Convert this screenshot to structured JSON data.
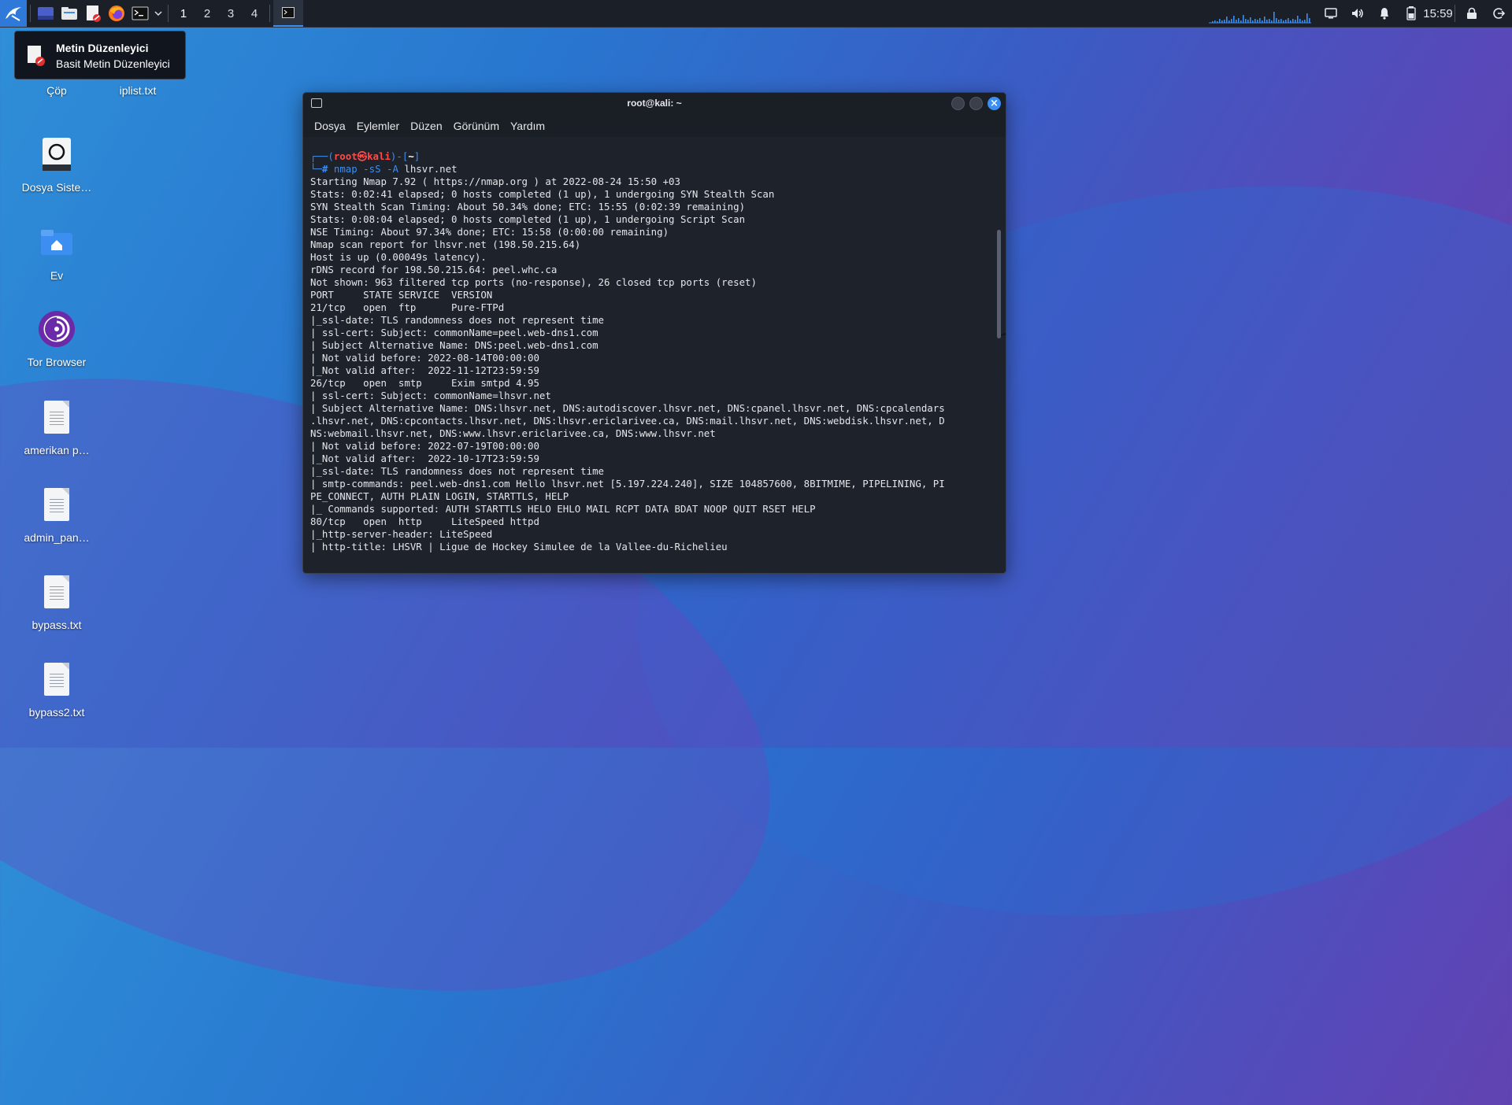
{
  "taskbar": {
    "workspaces": [
      "1",
      "2",
      "3",
      "4"
    ],
    "clock": "15:59"
  },
  "tooltip": {
    "title": "Metin Düzenleyici",
    "subtitle": "Basit Metin Düzenleyici"
  },
  "desktop_icons": [
    {
      "label": "Çöp",
      "icon": "trash-icon"
    },
    {
      "label": "iplist.txt",
      "icon": "text-file-icon"
    },
    {
      "label": "Dosya Siste…",
      "icon": "filesystem-icon"
    },
    {
      "label": "Ev",
      "icon": "home-folder-icon"
    },
    {
      "label": "Tor Browser",
      "icon": "tor-browser-icon"
    },
    {
      "label": "amerikan p…",
      "icon": "text-file-icon"
    },
    {
      "label": "admin_pan…",
      "icon": "text-file-icon"
    },
    {
      "label": "bypass.txt",
      "icon": "text-file-icon"
    },
    {
      "label": "bypass2.txt",
      "icon": "text-file-icon"
    }
  ],
  "terminal": {
    "title": "root@kali: ~",
    "menu": [
      "Dosya",
      "Eylemler",
      "Düzen",
      "Görünüm",
      "Yardım"
    ],
    "prompt": {
      "frame_open": "┌──(",
      "user": "root㉿kali",
      "frame_mid": ")-[",
      "dir": "~",
      "frame_close": "]",
      "frame_bottom": "└─",
      "hash": "#",
      "command": "nmap -sS -A",
      "argument": "lhsvr.net"
    },
    "output": [
      "Starting Nmap 7.92 ( https://nmap.org ) at 2022-08-24 15:50 +03",
      "Stats: 0:02:41 elapsed; 0 hosts completed (1 up), 1 undergoing SYN Stealth Scan",
      "SYN Stealth Scan Timing: About 50.34% done; ETC: 15:55 (0:02:39 remaining)",
      "Stats: 0:08:04 elapsed; 0 hosts completed (1 up), 1 undergoing Script Scan",
      "NSE Timing: About 97.34% done; ETC: 15:58 (0:00:00 remaining)",
      "Nmap scan report for lhsvr.net (198.50.215.64)",
      "Host is up (0.00049s latency).",
      "rDNS record for 198.50.215.64: peel.whc.ca",
      "Not shown: 963 filtered tcp ports (no-response), 26 closed tcp ports (reset)",
      "PORT     STATE SERVICE  VERSION",
      "21/tcp   open  ftp      Pure-FTPd",
      "|_ssl-date: TLS randomness does not represent time",
      "| ssl-cert: Subject: commonName=peel.web-dns1.com",
      "| Subject Alternative Name: DNS:peel.web-dns1.com",
      "| Not valid before: 2022-08-14T00:00:00",
      "|_Not valid after:  2022-11-12T23:59:59",
      "26/tcp   open  smtp     Exim smtpd 4.95",
      "| ssl-cert: Subject: commonName=lhsvr.net",
      "| Subject Alternative Name: DNS:lhsvr.net, DNS:autodiscover.lhsvr.net, DNS:cpanel.lhsvr.net, DNS:cpcalendars",
      ".lhsvr.net, DNS:cpcontacts.lhsvr.net, DNS:lhsvr.ericlarivee.ca, DNS:mail.lhsvr.net, DNS:webdisk.lhsvr.net, D",
      "NS:webmail.lhsvr.net, DNS:www.lhsvr.ericlarivee.ca, DNS:www.lhsvr.net",
      "| Not valid before: 2022-07-19T00:00:00",
      "|_Not valid after:  2022-10-17T23:59:59",
      "|_ssl-date: TLS randomness does not represent time",
      "| smtp-commands: peel.web-dns1.com Hello lhsvr.net [5.197.224.240], SIZE 104857600, 8BITMIME, PIPELINING, PI",
      "PE_CONNECT, AUTH PLAIN LOGIN, STARTTLS, HELP",
      "|_ Commands supported: AUTH STARTTLS HELO EHLO MAIL RCPT DATA BDAT NOOP QUIT RSET HELP",
      "80/tcp   open  http     LiteSpeed httpd",
      "|_http-server-header: LiteSpeed",
      "| http-title: LHSVR | Ligue de Hockey Simulee de la Vallee-du-Richelieu"
    ]
  }
}
